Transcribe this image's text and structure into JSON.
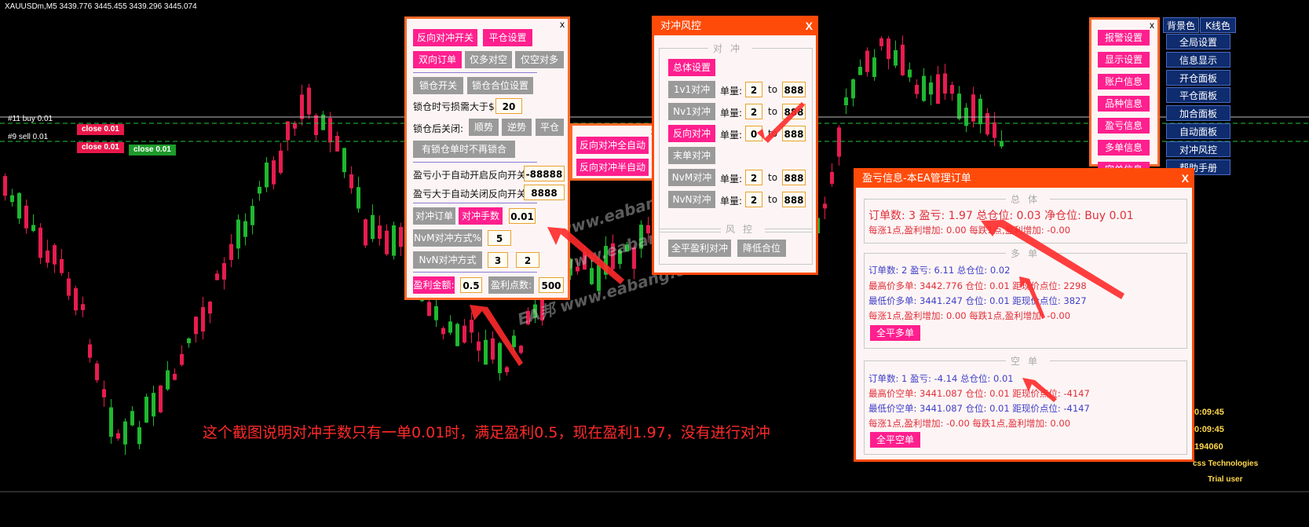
{
  "chart": {
    "header": "XAUUSDm,M5  3439.776 3445.455 3439.296 3445.074",
    "order_labels": [
      "#11 buy 0.01",
      "#9 sell 0.01"
    ],
    "close_tags": [
      "close 0.01",
      "close 0.01",
      "close 0.01"
    ],
    "colors": {
      "bull": "#1fb830",
      "bear": "#e81c4f",
      "grid": "#2b2b2b",
      "dash": "#1fc93a",
      "tag_red": "#e8174a",
      "tag_green": "#1e9b2c"
    }
  },
  "panel_hedge": {
    "close": "x",
    "btn_reverse_switch": "反向对冲开关",
    "btn_close_settings": "平仓设置",
    "btn_dual_order": "双向订单",
    "btn_long_hedge_short": "仅多对空",
    "btn_short_hedge_long": "仅空对多",
    "btn_lock_switch": "锁仓开关",
    "btn_lock_settings": "锁仓合位设置",
    "lock_loss_label": "锁仓时亏损需大于$:",
    "lock_loss_value": "20",
    "after_lock_label": "锁仓后关闭:",
    "btn_trend": "顺势",
    "btn_counter": "逆势",
    "btn_close": "平仓",
    "btn_no_relock": "有锁仓单时不再锁合",
    "auto_open_label": "盈亏小于自动开启反向开关:",
    "auto_open_value": "-88888",
    "auto_close_label": "盈亏大于自动关闭反向开关:",
    "auto_close_value": "8888",
    "btn_hedge_orders": "对冲订单",
    "btn_hedge_lots": "对冲手数",
    "hedge_lots_value": "0.01",
    "btn_nvm": "NvM对冲方式%",
    "nvm_value": "5",
    "btn_nvn": "NvN对冲方式",
    "nvn_value_a": "3",
    "nvn_value_b": "2",
    "btn_profit_amount": "盈利金额:",
    "profit_amount_value": "0.5",
    "btn_profit_points": "盈利点数:",
    "profit_points_value": "500"
  },
  "panel_auto": {
    "close": "x",
    "btn_full_auto": "反向对冲全自动",
    "btn_half_auto": "反向对冲半自动"
  },
  "panel_risk": {
    "title": "对冲风控",
    "close": "X",
    "group_hedge": "对冲",
    "group_risk": "风控",
    "btn_overall": "总体设置",
    "lot_label": "单量:",
    "to": "to",
    "rows": [
      {
        "btn": "1v1对冲",
        "from": "2",
        "to": "888"
      },
      {
        "btn": "Nv1对冲",
        "from": "2",
        "to": "888"
      },
      {
        "btn": "反向对冲",
        "from": "0",
        "to": "888"
      },
      {
        "btn": "末单对冲"
      },
      {
        "btn": "NvM对冲",
        "from": "2",
        "to": "888"
      },
      {
        "btn": "NvN对冲",
        "from": "2",
        "to": "888"
      }
    ],
    "btn_close_all": "全平盈利对冲",
    "btn_reduce": "降低合位"
  },
  "panel_side": {
    "close": "x",
    "buttons": [
      "报警设置",
      "显示设置",
      "账户信息",
      "品种信息",
      "盈亏信息",
      "多单信息",
      "空单信息"
    ]
  },
  "right_menu": {
    "top": [
      "背景色",
      "K线色"
    ],
    "items": [
      "全局设置",
      "信息显示",
      "开仓面板",
      "平仓面板",
      "加合面板",
      "自动面板",
      "对冲风控",
      "帮助手册"
    ]
  },
  "panel_pnl": {
    "title": "盈亏信息-本EA管理订单",
    "close": "X",
    "total_group": "总体",
    "total_line": "订单数: 3  盈亏: 1.97  总仓位: 0.03  净仓位: Buy 0.01",
    "total_sub": "每涨1点,盈利增加: 0.00    每跌1点,盈利增加: -0.00",
    "long_group": "多单",
    "long_lines": [
      "订单数: 2  盈亏: 6.11  总仓位: 0.02",
      "最高价多单: 3442.776  仓位: 0.01  距现价点位: 2298",
      "最低价多单: 3441.247  仓位: 0.01  距现价点位: 3827",
      "每涨1点,盈利增加: 0.00    每跌1点,盈利增加: -0.00"
    ],
    "btn_close_long": "全平多单",
    "short_group": "空单",
    "short_lines": [
      "订单数: 1  盈亏: -4.14  总仓位: 0.01",
      "最高价空单: 3441.087  仓位: 0.01  距现价点位: -4147",
      "最低价空单: 3441.087  仓位: 0.01  距现价点位: -4147",
      "每涨1点,盈利增加: -0.00    每跌1点,盈利增加: 0.00"
    ],
    "btn_close_short": "全平空单"
  },
  "clock": [
    "0:09:45",
    "0:09:45",
    "194060"
  ],
  "footer": [
    "css Technologies",
    "Trial user"
  ],
  "watermark": "EA邦 www.eabang.com",
  "caption": "这个截图说明对冲手数只有一单0.01时，满足盈利0.5，现在盈利1.97，没有进行对冲"
}
